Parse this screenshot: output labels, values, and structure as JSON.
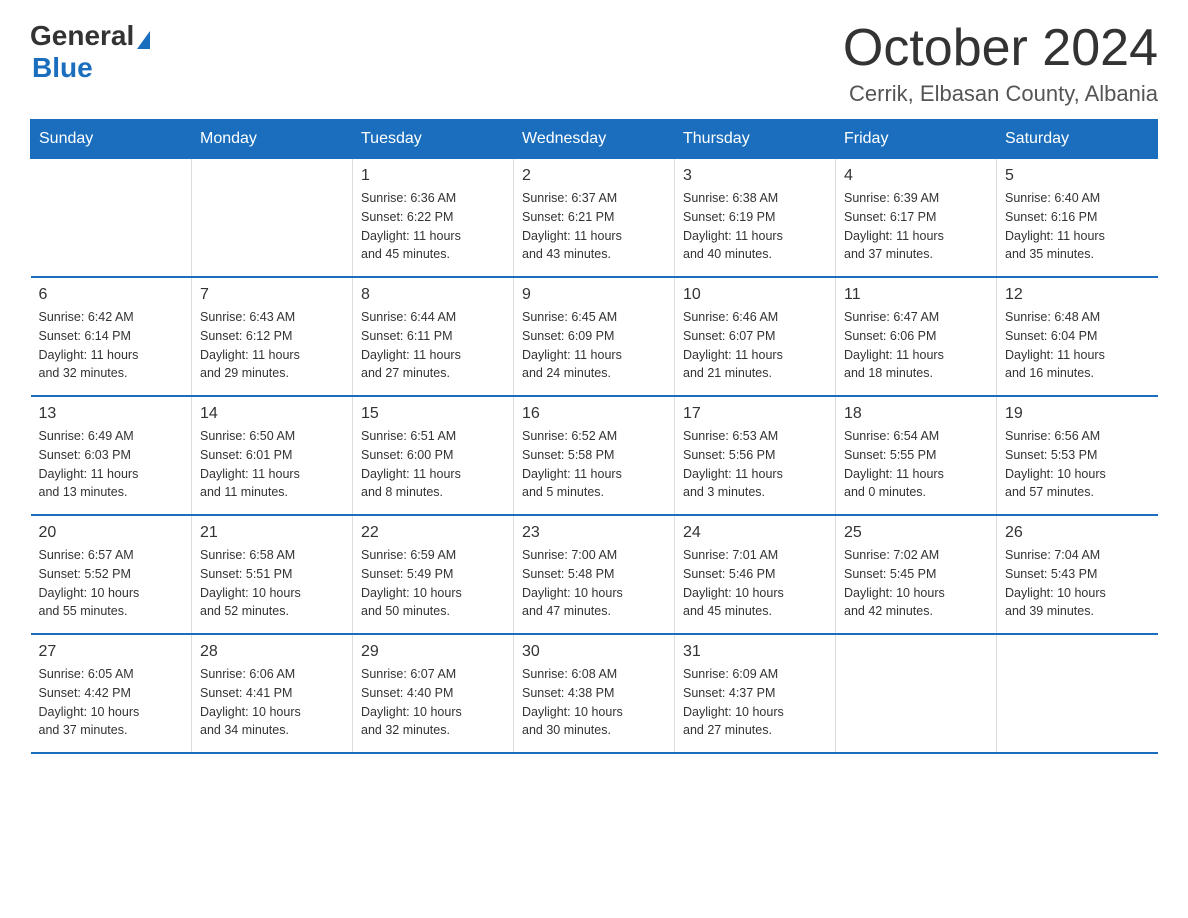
{
  "header": {
    "logo_general": "General",
    "logo_blue": "Blue",
    "main_title": "October 2024",
    "subtitle": "Cerrik, Elbasan County, Albania"
  },
  "calendar": {
    "days_of_week": [
      "Sunday",
      "Monday",
      "Tuesday",
      "Wednesday",
      "Thursday",
      "Friday",
      "Saturday"
    ],
    "weeks": [
      [
        {
          "day": "",
          "info": ""
        },
        {
          "day": "",
          "info": ""
        },
        {
          "day": "1",
          "info": "Sunrise: 6:36 AM\nSunset: 6:22 PM\nDaylight: 11 hours\nand 45 minutes."
        },
        {
          "day": "2",
          "info": "Sunrise: 6:37 AM\nSunset: 6:21 PM\nDaylight: 11 hours\nand 43 minutes."
        },
        {
          "day": "3",
          "info": "Sunrise: 6:38 AM\nSunset: 6:19 PM\nDaylight: 11 hours\nand 40 minutes."
        },
        {
          "day": "4",
          "info": "Sunrise: 6:39 AM\nSunset: 6:17 PM\nDaylight: 11 hours\nand 37 minutes."
        },
        {
          "day": "5",
          "info": "Sunrise: 6:40 AM\nSunset: 6:16 PM\nDaylight: 11 hours\nand 35 minutes."
        }
      ],
      [
        {
          "day": "6",
          "info": "Sunrise: 6:42 AM\nSunset: 6:14 PM\nDaylight: 11 hours\nand 32 minutes."
        },
        {
          "day": "7",
          "info": "Sunrise: 6:43 AM\nSunset: 6:12 PM\nDaylight: 11 hours\nand 29 minutes."
        },
        {
          "day": "8",
          "info": "Sunrise: 6:44 AM\nSunset: 6:11 PM\nDaylight: 11 hours\nand 27 minutes."
        },
        {
          "day": "9",
          "info": "Sunrise: 6:45 AM\nSunset: 6:09 PM\nDaylight: 11 hours\nand 24 minutes."
        },
        {
          "day": "10",
          "info": "Sunrise: 6:46 AM\nSunset: 6:07 PM\nDaylight: 11 hours\nand 21 minutes."
        },
        {
          "day": "11",
          "info": "Sunrise: 6:47 AM\nSunset: 6:06 PM\nDaylight: 11 hours\nand 18 minutes."
        },
        {
          "day": "12",
          "info": "Sunrise: 6:48 AM\nSunset: 6:04 PM\nDaylight: 11 hours\nand 16 minutes."
        }
      ],
      [
        {
          "day": "13",
          "info": "Sunrise: 6:49 AM\nSunset: 6:03 PM\nDaylight: 11 hours\nand 13 minutes."
        },
        {
          "day": "14",
          "info": "Sunrise: 6:50 AM\nSunset: 6:01 PM\nDaylight: 11 hours\nand 11 minutes."
        },
        {
          "day": "15",
          "info": "Sunrise: 6:51 AM\nSunset: 6:00 PM\nDaylight: 11 hours\nand 8 minutes."
        },
        {
          "day": "16",
          "info": "Sunrise: 6:52 AM\nSunset: 5:58 PM\nDaylight: 11 hours\nand 5 minutes."
        },
        {
          "day": "17",
          "info": "Sunrise: 6:53 AM\nSunset: 5:56 PM\nDaylight: 11 hours\nand 3 minutes."
        },
        {
          "day": "18",
          "info": "Sunrise: 6:54 AM\nSunset: 5:55 PM\nDaylight: 11 hours\nand 0 minutes."
        },
        {
          "day": "19",
          "info": "Sunrise: 6:56 AM\nSunset: 5:53 PM\nDaylight: 10 hours\nand 57 minutes."
        }
      ],
      [
        {
          "day": "20",
          "info": "Sunrise: 6:57 AM\nSunset: 5:52 PM\nDaylight: 10 hours\nand 55 minutes."
        },
        {
          "day": "21",
          "info": "Sunrise: 6:58 AM\nSunset: 5:51 PM\nDaylight: 10 hours\nand 52 minutes."
        },
        {
          "day": "22",
          "info": "Sunrise: 6:59 AM\nSunset: 5:49 PM\nDaylight: 10 hours\nand 50 minutes."
        },
        {
          "day": "23",
          "info": "Sunrise: 7:00 AM\nSunset: 5:48 PM\nDaylight: 10 hours\nand 47 minutes."
        },
        {
          "day": "24",
          "info": "Sunrise: 7:01 AM\nSunset: 5:46 PM\nDaylight: 10 hours\nand 45 minutes."
        },
        {
          "day": "25",
          "info": "Sunrise: 7:02 AM\nSunset: 5:45 PM\nDaylight: 10 hours\nand 42 minutes."
        },
        {
          "day": "26",
          "info": "Sunrise: 7:04 AM\nSunset: 5:43 PM\nDaylight: 10 hours\nand 39 minutes."
        }
      ],
      [
        {
          "day": "27",
          "info": "Sunrise: 6:05 AM\nSunset: 4:42 PM\nDaylight: 10 hours\nand 37 minutes."
        },
        {
          "day": "28",
          "info": "Sunrise: 6:06 AM\nSunset: 4:41 PM\nDaylight: 10 hours\nand 34 minutes."
        },
        {
          "day": "29",
          "info": "Sunrise: 6:07 AM\nSunset: 4:40 PM\nDaylight: 10 hours\nand 32 minutes."
        },
        {
          "day": "30",
          "info": "Sunrise: 6:08 AM\nSunset: 4:38 PM\nDaylight: 10 hours\nand 30 minutes."
        },
        {
          "day": "31",
          "info": "Sunrise: 6:09 AM\nSunset: 4:37 PM\nDaylight: 10 hours\nand 27 minutes."
        },
        {
          "day": "",
          "info": ""
        },
        {
          "day": "",
          "info": ""
        }
      ]
    ]
  }
}
